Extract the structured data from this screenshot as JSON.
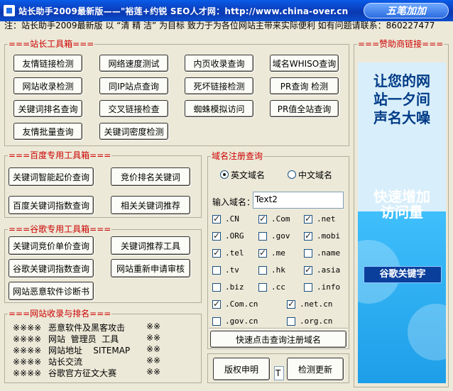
{
  "title": {
    "text": "站长助手2009最新版——\"裕莲+约锐  SEO人才网：http://www.china-over.cn",
    "logo": "五笔加加"
  },
  "notice": "注：站长助手2009最新版 以 “清 精 洁” 为目标 致力于为各位网站主带来实际便利 如有问题请联系：860227477",
  "webmaster_tools": {
    "title": "===站长工具箱===",
    "buttons": [
      "友情链接检测",
      "网络速度测试",
      "内页收录查询",
      "域名WHISO查询",
      "网站收录检测",
      "同IP站点查询",
      "死坏链接检测",
      "PR查询 检测",
      "关键词排名查询",
      "交叉链接检查",
      "蜘蛛模拟访问",
      "PR值全站查询",
      "友情批量查询",
      "关键词密度检测"
    ]
  },
  "baidu_tools": {
    "title": "===百度专用工具箱===",
    "buttons": [
      "关键词智能起价查询",
      "竞价排名关键词",
      "百度关键词指数查询",
      "相关关键词推荐"
    ]
  },
  "google_tools": {
    "title": "===谷歌专用工具箱===",
    "buttons": [
      "关键词竞价单价查询",
      "关键词推荐工具",
      "谷歌关键词指数查询",
      "网站重新申请审核",
      "网站恶意软件诊断书"
    ]
  },
  "ranking": {
    "title": "===网站收录与排名===",
    "rows": [
      {
        "prefix": "※※※※",
        "text": "恶意软件及黑客攻击",
        "suffix": "※※"
      },
      {
        "prefix": "※※※※",
        "text": "网站  管理员  工具",
        "suffix": "※※"
      },
      {
        "prefix": "※※※※",
        "text": "网站地址    SITEMAP",
        "suffix": "※※"
      },
      {
        "prefix": "※※※※",
        "text": "站长交流",
        "suffix": "※※"
      },
      {
        "prefix": "※※※※",
        "text": "谷歌官方征文大赛",
        "suffix": "※※"
      }
    ]
  },
  "domain_query": {
    "title": "域名注册查询",
    "radio_en": "英文域名",
    "radio_cn": "中文域名",
    "radio_selected": "en",
    "input_label": "输入域名：",
    "input_value": "Text2",
    "checkboxes": [
      {
        "label": ".CN",
        "checked": true
      },
      {
        "label": ".Com",
        "checked": true
      },
      {
        "label": ".net",
        "checked": true
      },
      {
        "label": ".ORG",
        "checked": true
      },
      {
        "label": ".gov",
        "checked": false
      },
      {
        "label": ".mobi",
        "checked": true
      },
      {
        "label": ".tel",
        "checked": true
      },
      {
        "label": ".me",
        "checked": true
      },
      {
        "label": ".name",
        "checked": false
      },
      {
        "label": ".tv",
        "checked": false
      },
      {
        "label": ".hk",
        "checked": false
      },
      {
        "label": ".asia",
        "checked": true
      },
      {
        "label": ".biz",
        "checked": false
      },
      {
        "label": ".cc",
        "checked": false
      },
      {
        "label": ".info",
        "checked": false
      },
      {
        "label": ".Com.cn",
        "checked": true
      },
      {
        "label": ".net.cn",
        "checked": true
      },
      {
        "label": ".gov.cn",
        "checked": false
      },
      {
        "label": ".org.cn",
        "checked": false
      }
    ],
    "query_button": "快速点击查询注册域名"
  },
  "footer": {
    "copyright_button": "版权申明",
    "field_value": "T",
    "update_button": "检测更新"
  },
  "sponsor": {
    "title": "===赞助商链接===",
    "headline": [
      "让您的网",
      "站一夕间",
      "声名大噪"
    ],
    "slogan": [
      "快速增加",
      "访问量"
    ],
    "keyword": "谷歌关键字"
  }
}
